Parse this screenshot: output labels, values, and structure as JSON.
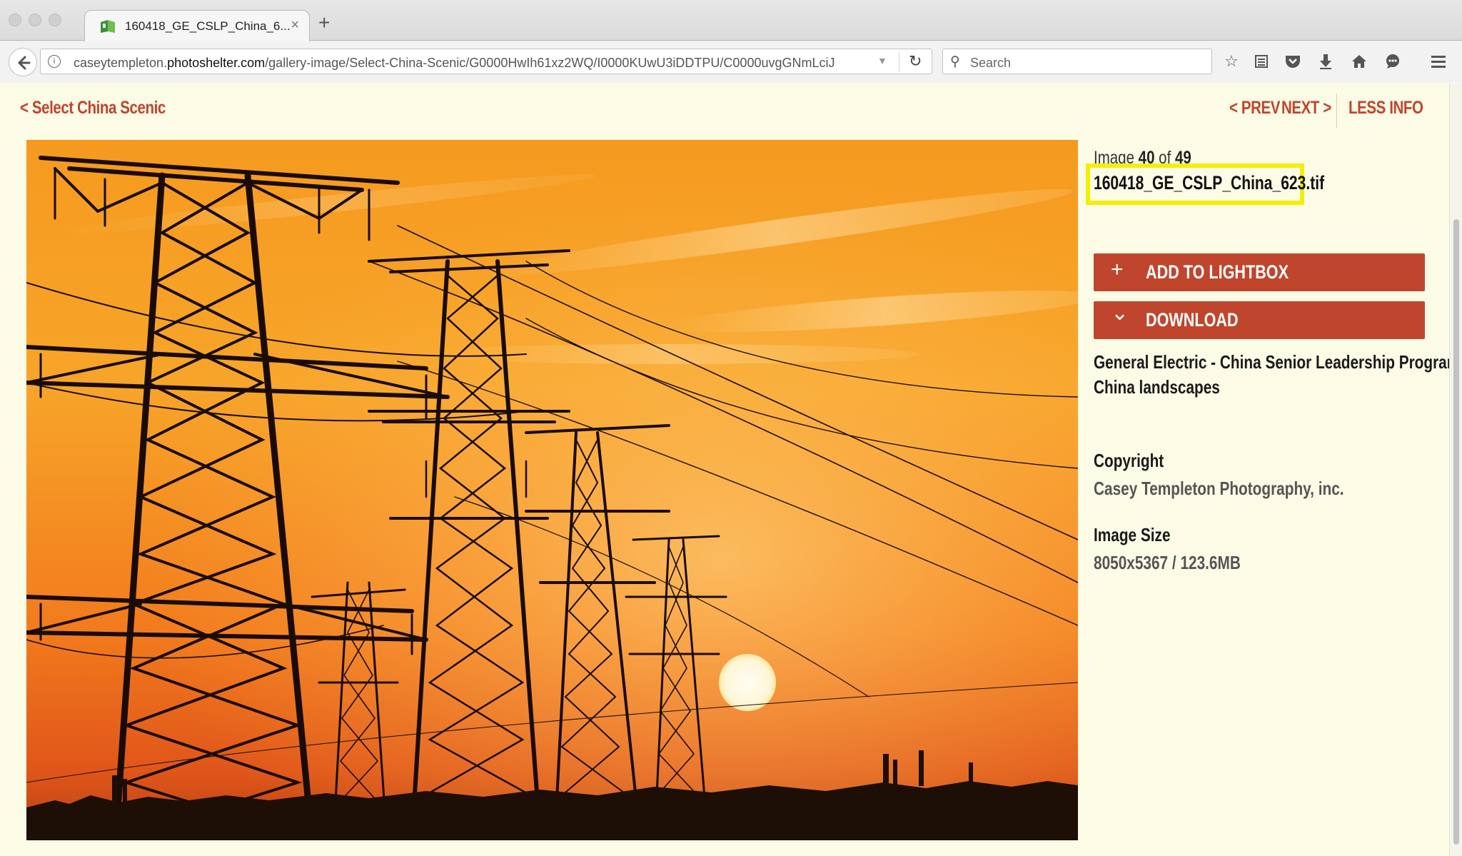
{
  "browser": {
    "tab_title": "160418_GE_CSLP_China_6...",
    "url_host_pre": "caseytempleton.",
    "url_host_main": "photoshelter.com",
    "url_path": "/gallery-image/Select-China-Scenic/G0000HwIh61xz2WQ/I0000KUwU3iDDTPU/C0000uvgGNmLciJ",
    "search_placeholder": "Search"
  },
  "nav": {
    "back_label": "< Select China Scenic",
    "prev_label": "< PREV",
    "next_label": "NEXT >",
    "less_info_label": "LESS INFO"
  },
  "image_info": {
    "counter_prefix": "Image ",
    "current": "40",
    "counter_mid": " of ",
    "total": "49",
    "filename": "160418_GE_CSLP_China_623.tif"
  },
  "actions": {
    "add_icon": "+",
    "add_label": "ADD TO LIGHTBOX",
    "download_icon": "⌄",
    "download_label": "DOWNLOAD"
  },
  "description": {
    "line1": "General Electric - China Senior Leadership Program",
    "line2": "China landscapes"
  },
  "copyright": {
    "label": "Copyright",
    "value": "Casey Templeton Photography, inc."
  },
  "image_size": {
    "label": "Image Size",
    "value": "8050x5367 / 123.6MB"
  },
  "colors": {
    "accent": "#c0452d",
    "highlight": "#f4ef00",
    "page_bg": "#fcfbe6"
  }
}
